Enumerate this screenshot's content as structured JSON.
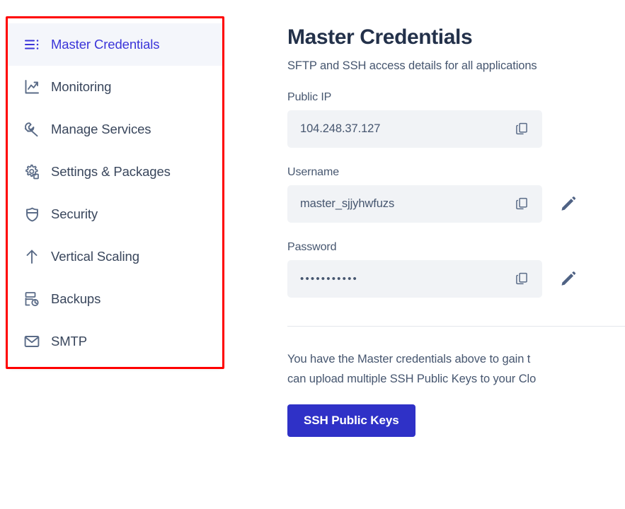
{
  "sidebar": {
    "items": [
      {
        "label": "Master Credentials",
        "icon": "list-lines-icon",
        "active": true
      },
      {
        "label": "Monitoring",
        "icon": "chart-line-icon",
        "active": false
      },
      {
        "label": "Manage Services",
        "icon": "wrench-icon",
        "active": false
      },
      {
        "label": "Settings & Packages",
        "icon": "gear-package-icon",
        "active": false
      },
      {
        "label": "Security",
        "icon": "shield-icon",
        "active": false
      },
      {
        "label": "Vertical Scaling",
        "icon": "arrow-up-icon",
        "active": false
      },
      {
        "label": "Backups",
        "icon": "backup-restore-icon",
        "active": false
      },
      {
        "label": "SMTP",
        "icon": "envelope-icon",
        "active": false
      }
    ]
  },
  "main": {
    "title": "Master Credentials",
    "subtitle": "SFTP and SSH access details for all applications",
    "fields": [
      {
        "label": "Public IP",
        "value": "104.248.37.127",
        "masked": false,
        "copy_icon": "copy-icon",
        "has_edit": false,
        "edit_icon": "pencil-icon"
      },
      {
        "label": "Username",
        "value": "master_sjjyhwfuzs",
        "masked": false,
        "copy_icon": "copy-icon",
        "has_edit": true,
        "edit_icon": "pencil-icon"
      },
      {
        "label": "Password",
        "value": "•••••••••••",
        "masked": true,
        "copy_icon": "copy-icon",
        "has_edit": true,
        "edit_icon": "pencil-icon"
      }
    ],
    "info_line_1": "You have the Master credentials above to gain t",
    "info_line_2": "can upload multiple SSH Public Keys to your Clo",
    "ssh_button_label": "SSH Public Keys"
  },
  "colors": {
    "accent": "#3b35d9",
    "button": "#2f31c7",
    "text": "#46566f",
    "heading": "#23314a",
    "field_bg": "#f1f3f6",
    "active_bg": "#f4f6fb",
    "highlight_border": "#ff0000"
  }
}
